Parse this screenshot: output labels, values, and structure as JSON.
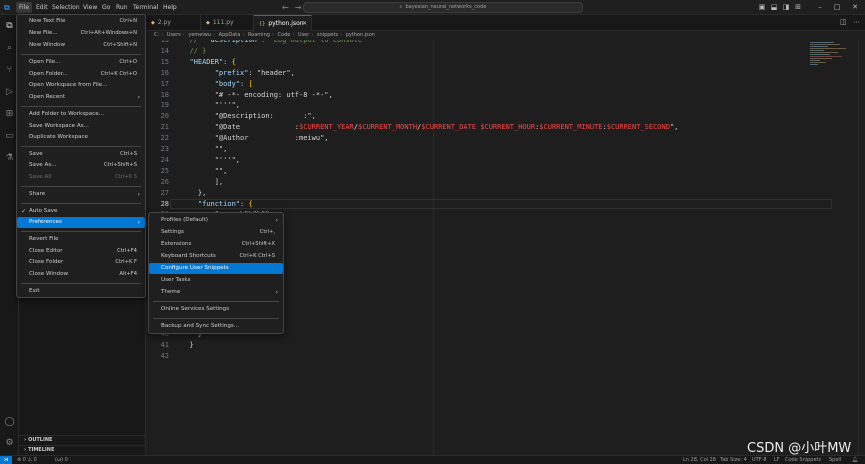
{
  "titlebar": {
    "menus": [
      "File",
      "Edit",
      "Selection",
      "View",
      "Go",
      "Run",
      "Terminal",
      "Help"
    ],
    "search": "bayesian_neural_networks_code",
    "app_icon": "vscode-logo-icon"
  },
  "tabs": [
    {
      "label": "2.py"
    },
    {
      "label": "111.py"
    },
    {
      "label": "python.json"
    }
  ],
  "breadcrumb": [
    "C:",
    "Users",
    "yemeiwu",
    "AppData",
    "Roaming",
    "Code",
    "User",
    "snippets",
    "python.json"
  ],
  "editor": {
    "lines": [
      {
        "no": "13",
        "text": "  //  \"description\": \"Log output to console\""
      },
      {
        "no": "14",
        "text": "  // }"
      },
      {
        "no": "15",
        "text": "  \"HEADER\": {"
      },
      {
        "no": "16",
        "text": "        \"prefix\": \"header\","
      },
      {
        "no": "17",
        "text": "        \"body\": ["
      },
      {
        "no": "18",
        "text": "        \"# -*- encoding: utf-8 -*-\","
      },
      {
        "no": "19",
        "text": "        \"'''\","
      },
      {
        "no": "20",
        "text": "        \"@Description:       :\","
      },
      {
        "no": "21",
        "text": "        \"@Date             :$CURRENT_YEAR/$CURRENT_MONTH/$CURRENT_DATE $CURRENT_HOUR:$CURRENT_MINUTE:$CURRENT_SECOND\","
      },
      {
        "no": "22",
        "text": "        \"@Author           :meiwu\","
      },
      {
        "no": "23",
        "text": "        \"\","
      },
      {
        "no": "24",
        "text": "        \"'''\","
      },
      {
        "no": "25",
        "text": "        \"\","
      },
      {
        "no": "26",
        "text": "        ],"
      },
      {
        "no": "27",
        "text": "    },"
      },
      {
        "no": "28",
        "text": "    \"function\": {"
      },
      {
        "no": "29",
        "text": "        \"  ;  \\\"\\\"\\\"\","
      },
      {
        "no": "30",
        "text": ""
      },
      {
        "no": "31",
        "text": "        \","
      },
      {
        "no": "32",
        "text": "        :\","
      },
      {
        "no": "33",
        "text": "        :\","
      },
      {
        "no": "34",
        "text": "        :\","
      },
      {
        "no": "35",
        "text": ""
      },
      {
        "no": "36",
        "text": ""
      },
      {
        "no": "37",
        "text": ""
      },
      {
        "no": "38",
        "text": ""
      },
      {
        "no": "39",
        "text": ""
      },
      {
        "no": "40",
        "text": "    }"
      },
      {
        "no": "41",
        "text": "  }"
      },
      {
        "no": "42",
        "text": ""
      }
    ]
  },
  "file_menu": {
    "items": [
      {
        "label": "New Text File",
        "kb": "Ctrl+N"
      },
      {
        "label": "New File...",
        "kb": "Ctrl+Alt+Windows+N"
      },
      {
        "label": "New Window",
        "kb": "Ctrl+Shift+N"
      },
      {
        "label": "Open File...",
        "kb": "Ctrl+O"
      },
      {
        "label": "Open Folder...",
        "kb": "Ctrl+K Ctrl+O"
      },
      {
        "label": "Open Workspace from File...",
        "kb": ""
      },
      {
        "label": "Open Recent",
        "kb": ""
      },
      {
        "label": "Add Folder to Workspace...",
        "kb": ""
      },
      {
        "label": "Save Workspace As...",
        "kb": ""
      },
      {
        "label": "Duplicate Workspace",
        "kb": ""
      },
      {
        "label": "Save",
        "kb": "Ctrl+S"
      },
      {
        "label": "Save As...",
        "kb": "Ctrl+Shift+S"
      },
      {
        "label": "Save All",
        "kb": "Ctrl+K S"
      },
      {
        "label": "Share",
        "kb": ""
      },
      {
        "label": "Auto Save",
        "kb": ""
      },
      {
        "label": "Preferences",
        "kb": ""
      },
      {
        "label": "Revert File",
        "kb": ""
      },
      {
        "label": "Close Editor",
        "kb": "Ctrl+F4"
      },
      {
        "label": "Close Folder",
        "kb": "Ctrl+K F"
      },
      {
        "label": "Close Window",
        "kb": "Alt+F4"
      },
      {
        "label": "Exit",
        "kb": ""
      }
    ]
  },
  "pref_menu": {
    "items": [
      {
        "label": "Profiles (Default)",
        "kb": ""
      },
      {
        "label": "Settings",
        "kb": "Ctrl+,"
      },
      {
        "label": "Extensions",
        "kb": "Ctrl+Shift+X"
      },
      {
        "label": "Keyboard Shortcuts",
        "kb": "Ctrl+K Ctrl+S"
      },
      {
        "label": "Configure User Snippets",
        "kb": ""
      },
      {
        "label": "User Tasks",
        "kb": ""
      },
      {
        "label": "Theme",
        "kb": ""
      },
      {
        "label": "Online Services Settings",
        "kb": ""
      },
      {
        "label": "Backup and Sync Settings...",
        "kb": ""
      }
    ]
  },
  "sidebar": {
    "outline": "OUTLINE",
    "timeline": "TIMELINE"
  },
  "statusbar": {
    "problems": "⊗ 0 ⚠ 0",
    "ports": "(ω) 0",
    "position": "Ln 28, Col 28",
    "indent": "Tab Size: 4",
    "encoding": "UTF-8",
    "eol": "LF",
    "language": "Code Snippets",
    "spell": "Spell"
  },
  "watermark": "CSDN @小叶MW",
  "colors": {
    "accent": "#0078d4",
    "json_key": "#9cdcfe",
    "json_string": "#ce9178",
    "snippet_variable": "#f44747"
  }
}
